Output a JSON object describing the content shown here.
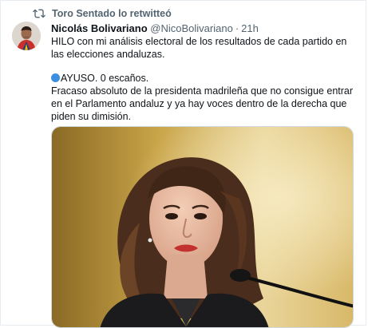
{
  "retweet": {
    "icon": "retweet-icon",
    "text": "Toro Sentado lo retwitteó"
  },
  "tweet": {
    "author_name": "Nicolás Bolivariano",
    "author_handle": "@NicoBolivariano",
    "separator": "·",
    "time": "21h",
    "avatar_icon": "user-avatar",
    "paragraph1": "HILO con mi análisis electoral de los resultados de cada partido en las elecciones andaluzas.",
    "paragraph2_line1": "AYUSO. 0 escaños.",
    "paragraph2_line2": "Fracaso absoluto de la presidenta madrileña que no consigue entrar en el Parlamento andaluz y ya hay voces dentro de la derecha que piden su dimisión.",
    "emoji_dot_color": "#3a8fe0",
    "media_icon": "photo-woman-at-microphone"
  },
  "colors": {
    "secondary_text": "#536471",
    "primary_text": "#0f1419",
    "border": "#cfd9de"
  }
}
